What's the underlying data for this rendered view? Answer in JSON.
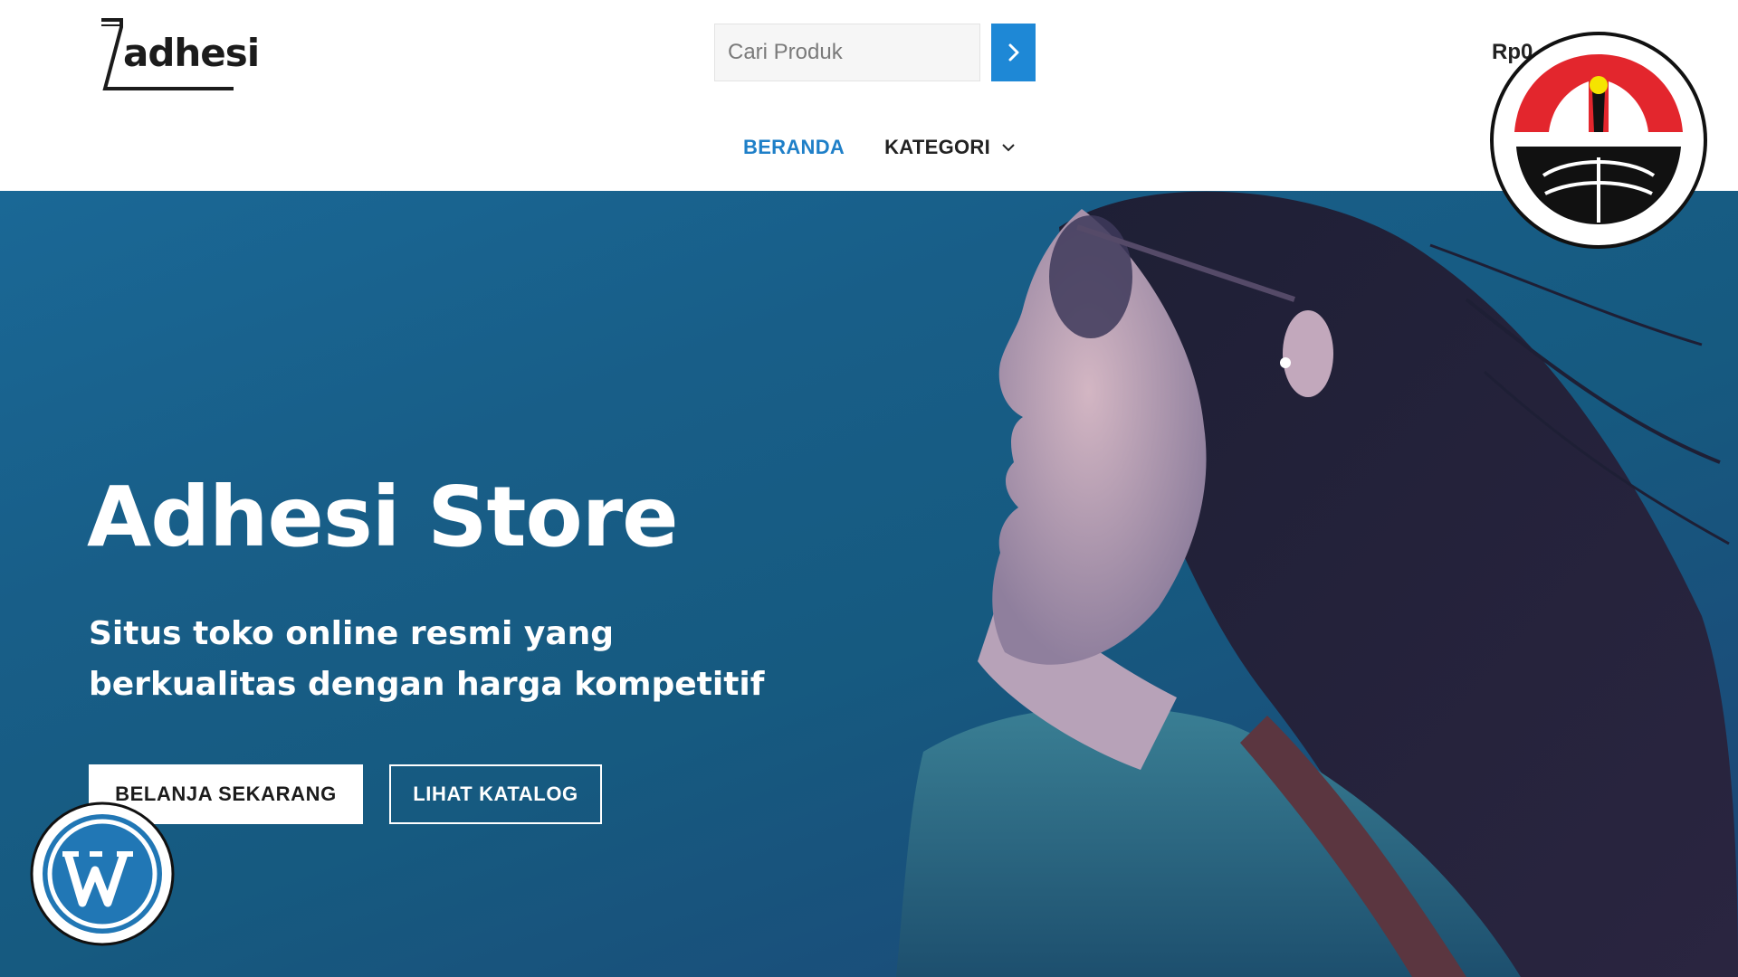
{
  "brand": {
    "logo_text": "adhesi",
    "logo_icon": "pen-nib-logo"
  },
  "search": {
    "placeholder": "Cari Produk",
    "button_icon": "chevron-right-icon"
  },
  "cart": {
    "total": "Rp0"
  },
  "nav": {
    "items": [
      {
        "label": "BERANDA",
        "active": true
      },
      {
        "label": "KATEGORI",
        "active": false,
        "icon": "chevron-down-icon"
      }
    ]
  },
  "hero": {
    "title": "Adhesi Store",
    "subtitle": "Situs toko online resmi yang berkualitas dengan harga kompetitif",
    "primary_button": "BELANJA SEKARANG",
    "secondary_button": "LIHAT KATALOG"
  },
  "overlays": {
    "top_right": "university-emblem",
    "bottom_left": "wordpress-logo"
  },
  "colors": {
    "accent": "#1e88d6",
    "nav_active": "#1e7fc8",
    "hero_bg": "#185e88",
    "emblem_red": "#e3262d",
    "emblem_yellow": "#f5e400",
    "wordpress_blue": "#2177b5"
  }
}
